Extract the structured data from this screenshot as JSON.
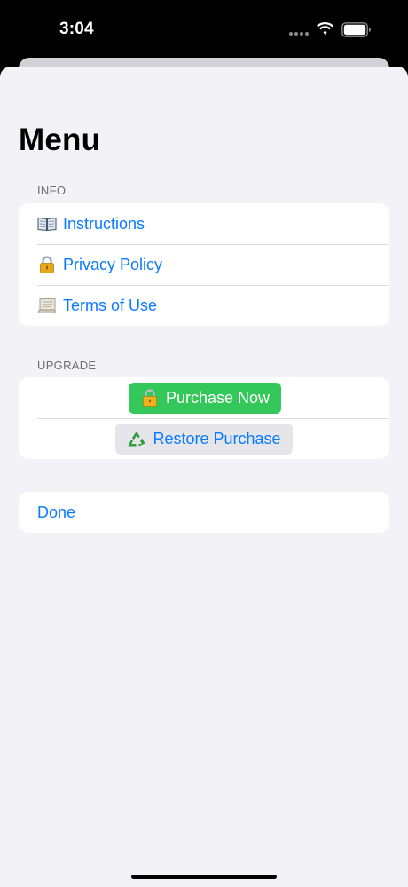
{
  "status_bar": {
    "time": "3:04",
    "icons": [
      "signal-dots-icon",
      "wifi-icon",
      "battery-icon"
    ]
  },
  "page": {
    "title": "Menu"
  },
  "info_section": {
    "header": "INFO",
    "items": [
      {
        "icon": "book-icon",
        "label": "Instructions"
      },
      {
        "icon": "lock-icon",
        "label": "Privacy Policy"
      },
      {
        "icon": "scroll-icon",
        "label": "Terms of Use"
      }
    ]
  },
  "upgrade_section": {
    "header": "UPGRADE",
    "purchase": {
      "icon": "lock-icon",
      "label": "Purchase Now"
    },
    "restore": {
      "icon": "recycle-icon",
      "label": "Restore Purchase"
    }
  },
  "done_section": {
    "label": "Done"
  },
  "colors": {
    "accent": "#0a7aff",
    "purchase_green": "#34c759",
    "sheet_background": "#f2f2f7",
    "section_header": "#6d6d72"
  }
}
